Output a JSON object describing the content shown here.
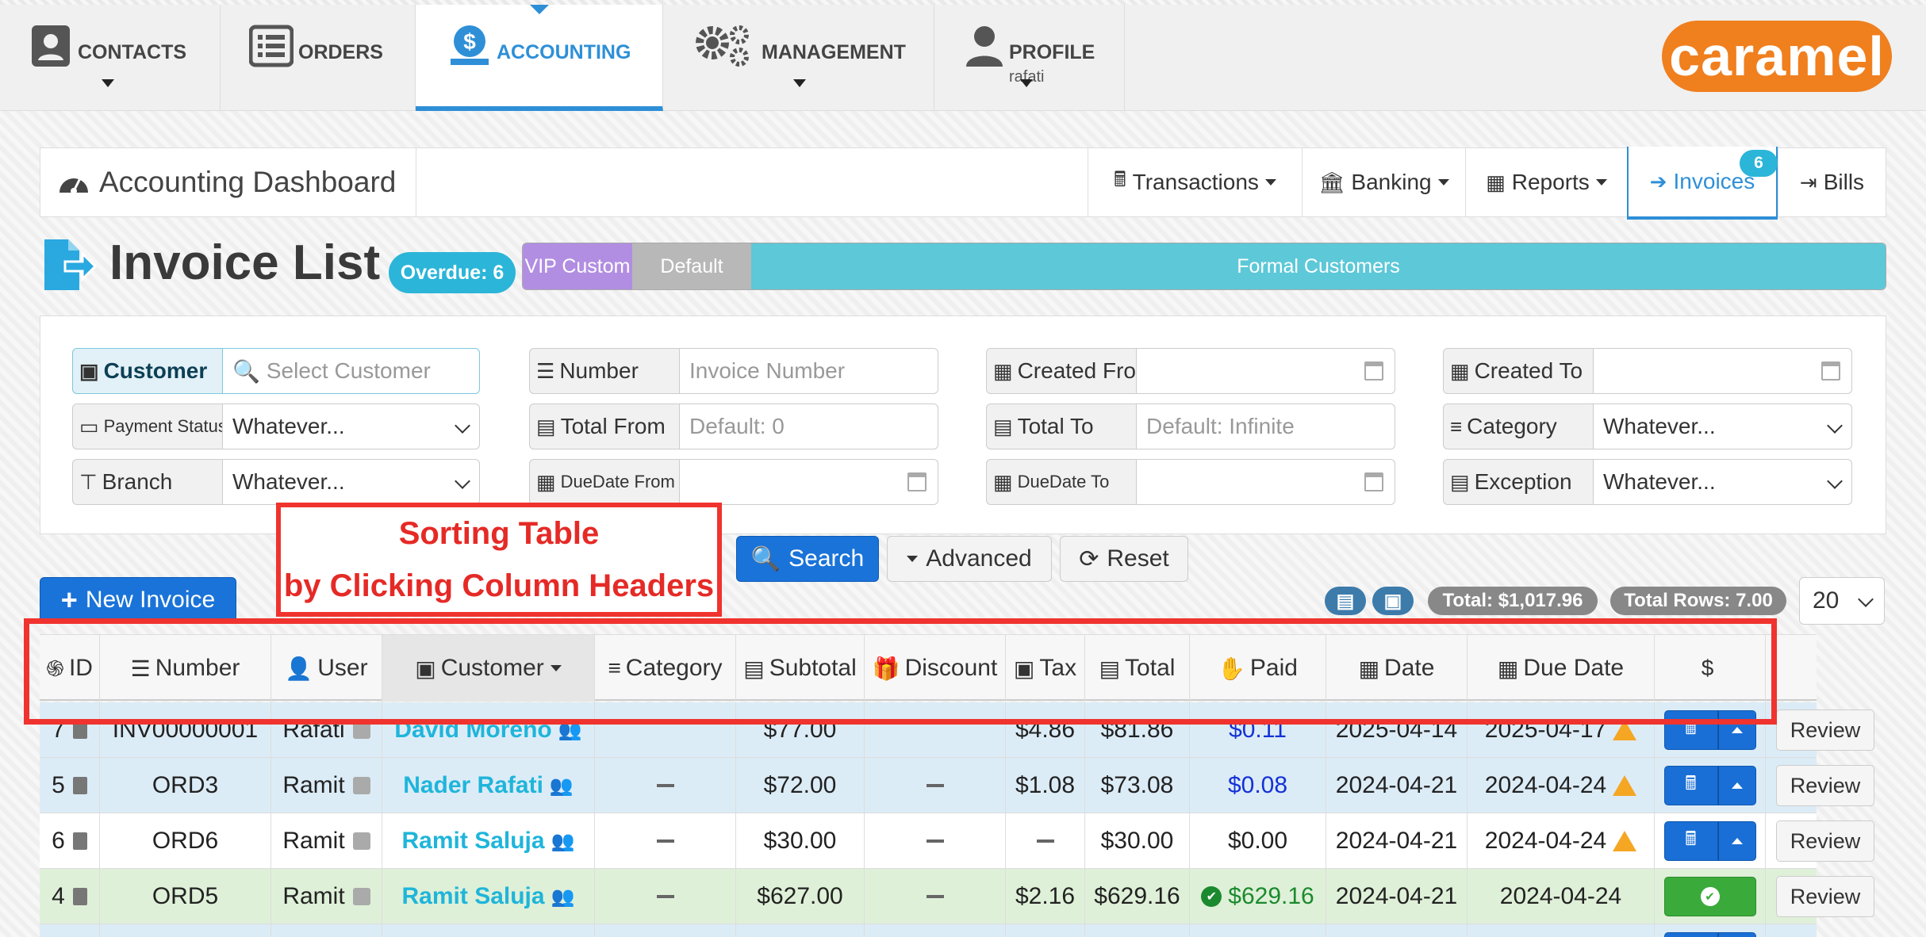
{
  "nav": {
    "items": [
      {
        "key": "contacts",
        "label": "CONTACTS",
        "sub": "",
        "has_caret": true
      },
      {
        "key": "orders",
        "label": "ORDERS",
        "sub": "",
        "has_caret": false
      },
      {
        "key": "accounting",
        "label": "ACCOUNTING",
        "sub": "",
        "has_caret": false,
        "active": true
      },
      {
        "key": "management",
        "label": "MANAGEMENT",
        "sub": "",
        "has_caret": true
      },
      {
        "key": "profile",
        "label": "PROFILE",
        "sub": "rafati",
        "has_caret": true
      }
    ],
    "logo_text": "caramel",
    "logo_color": "#f07f1e"
  },
  "dashboard": {
    "title": "Accounting Dashboard",
    "tabs": [
      {
        "label": "Transactions",
        "dropdown": true
      },
      {
        "label": "Banking",
        "dropdown": true
      },
      {
        "label": "Reports",
        "dropdown": true
      },
      {
        "label": "Invoices",
        "dropdown": false,
        "active": true,
        "badge": "6"
      },
      {
        "label": "Bills",
        "dropdown": false
      }
    ]
  },
  "invoice_list": {
    "title": "Invoice List",
    "overdue_label": "Overdue: 6",
    "categories": [
      {
        "label": "VIP Custom",
        "color": "#b18ee2"
      },
      {
        "label": "Default",
        "color": "#b8b8b8"
      },
      {
        "label": "Formal Customers",
        "color": "#5dc8d8"
      }
    ]
  },
  "filters": {
    "customer": {
      "label": "Customer",
      "placeholder": "Select Customer"
    },
    "number": {
      "label": "Number",
      "placeholder": "Invoice Number"
    },
    "created_from": {
      "label": "Created From",
      "value": ""
    },
    "created_to": {
      "label": "Created To",
      "value": ""
    },
    "payment_status": {
      "label": "Payment Status",
      "value": "Whatever..."
    },
    "total_from": {
      "label": "Total From",
      "placeholder": "Default: 0"
    },
    "total_to": {
      "label": "Total To",
      "placeholder": "Default: Infinite"
    },
    "category": {
      "label": "Category",
      "value": "Whatever..."
    },
    "branch": {
      "label": "Branch",
      "value": "Whatever..."
    },
    "duedate_from": {
      "label": "DueDate From",
      "value": ""
    },
    "duedate_to": {
      "label": "DueDate To",
      "value": ""
    },
    "exception": {
      "label": "Exception",
      "value": "Whatever..."
    }
  },
  "actions": {
    "search": "Search",
    "advanced": "Advanced",
    "reset": "Reset",
    "new_invoice": "New Invoice"
  },
  "annotation": {
    "line1": "Sorting Table",
    "line2": "by Clicking Column Headers"
  },
  "summary": {
    "total": "Total: $1,017.96",
    "total_rows": "Total Rows: 7.00",
    "page_size": "20"
  },
  "table": {
    "columns": [
      {
        "key": "id",
        "label": "ID"
      },
      {
        "key": "number",
        "label": "Number"
      },
      {
        "key": "user",
        "label": "User"
      },
      {
        "key": "customer",
        "label": "Customer",
        "sorted": true
      },
      {
        "key": "category",
        "label": "Category"
      },
      {
        "key": "subtotal",
        "label": "Subtotal"
      },
      {
        "key": "discount",
        "label": "Discount"
      },
      {
        "key": "tax",
        "label": "Tax"
      },
      {
        "key": "total",
        "label": "Total"
      },
      {
        "key": "paid",
        "label": "Paid"
      },
      {
        "key": "date",
        "label": "Date"
      },
      {
        "key": "due_date",
        "label": "Due Date"
      },
      {
        "key": "pay",
        "label": ""
      }
    ],
    "rows": [
      {
        "id": "7",
        "number": "INV00000001",
        "user": "Rafati",
        "customer": "David Moreno",
        "subtotal": "$77.00",
        "discount": "",
        "tax": "$4.86",
        "total": "$81.86",
        "paid": "$0.11",
        "date": "2025-04-14",
        "due_date": "2025-04-17",
        "status": "due",
        "color": "#dcecf7"
      },
      {
        "id": "5",
        "number": "ORD3",
        "user": "Ramit",
        "customer": "Nader Rafati",
        "subtotal": "$72.00",
        "discount": "—",
        "tax": "$1.08",
        "total": "$73.08",
        "paid": "$0.08",
        "date": "2024-04-21",
        "due_date": "2024-04-24",
        "status": "due",
        "color": "#dcecf7"
      },
      {
        "id": "6",
        "number": "ORD6",
        "user": "Ramit",
        "customer": "Ramit Saluja",
        "subtotal": "$30.00",
        "discount": "—",
        "tax": "—",
        "total": "$30.00",
        "paid": "$0.00",
        "date": "2024-04-21",
        "due_date": "2024-04-24",
        "status": "due",
        "color": "#ffffff"
      },
      {
        "id": "4",
        "number": "ORD5",
        "user": "Ramit",
        "customer": "Ramit Saluja",
        "subtotal": "$627.00",
        "discount": "—",
        "tax": "$2.16",
        "total": "$629.16",
        "paid": "$629.16",
        "date": "2024-04-21",
        "due_date": "2024-04-24",
        "status": "paid",
        "color": "#dff0d8"
      },
      {
        "id": "",
        "number": "",
        "user": "",
        "customer": "",
        "subtotal": "",
        "discount": "",
        "tax": "",
        "total": "",
        "paid": "",
        "date": "",
        "due_date": "",
        "status": "due",
        "color": "#dcecf7"
      }
    ],
    "review_label": "Review"
  }
}
